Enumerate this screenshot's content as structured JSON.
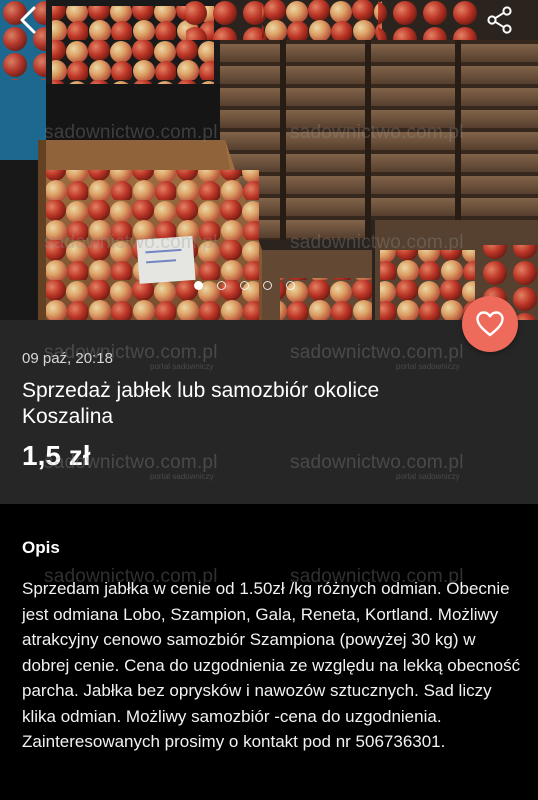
{
  "listing": {
    "timestamp": "09 paź, 20:18",
    "title": "Sprzedaż jabłek lub samozbiór okolice Koszalina",
    "price": "1,5 zł"
  },
  "gallery": {
    "image_count": 5,
    "active_index": 0
  },
  "description": {
    "heading": "Opis",
    "text": "Sprzedam jabłka w cenie od 1.50zł /kg różnych odmian. Obecnie jest odmiana Lobo, Szampion, Gala, Reneta, Kortland. Możliwy atrakcyjny cenowo samozbiór Szampiona (powyżej 30 kg) w dobrej cenie. Cena do uzgodnienia ze względu na lekką obecność parcha. Jabłka bez oprysków i nawozów sztucznych. Sad liczy klika odmian. Możliwy samozbiór -cena do uzgodnienia. Zainteresowanych prosimy o kontakt pod nr 506736301."
  },
  "watermark": {
    "text": "sadownictwo.com.pl",
    "subtext": "portal sadowniczy"
  },
  "icons": {
    "back": "chevron-left-icon",
    "share": "share-icon",
    "favorite": "heart-outline-icon"
  },
  "colors": {
    "card_background": "#262626",
    "page_background": "#000000",
    "favorite_button": "#ee6b5b",
    "text": "#ffffff"
  }
}
